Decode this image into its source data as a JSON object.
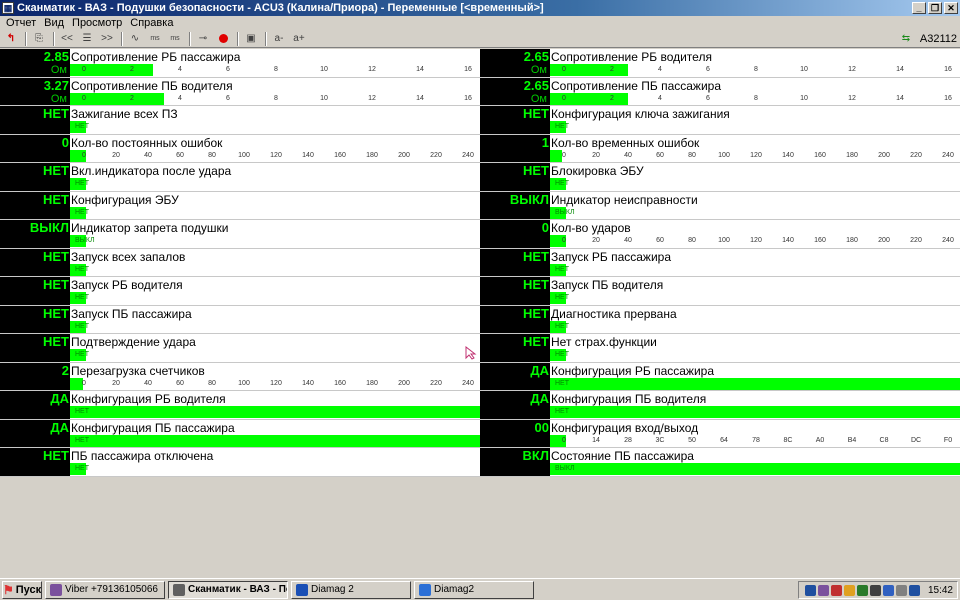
{
  "window": {
    "title": "Сканматик - ВАЗ - Подушки безопасности - ACU3 (Калина/Приора) - Переменные [<временный>]",
    "btn_minimize": "_",
    "btn_restore": "❐",
    "btn_close": "✕"
  },
  "menu": [
    "Отчет",
    "Вид",
    "Просмотр",
    "Справка"
  ],
  "toolbar": {
    "back": "<<",
    "forward": ">>",
    "ms1": "ms",
    "ms2": "ms",
    "a_minus": "a-",
    "a_plus": "a+",
    "vehicle": "А32112"
  },
  "params_left": [
    {
      "value": "2.85",
      "unit": "Ом",
      "name": "Сопротивление РБ пассажира",
      "type": "scale",
      "ticks": [
        "0",
        "2",
        "4",
        "6",
        "8",
        "10",
        "12",
        "14",
        "16"
      ],
      "bar_fraction": 0.178
    },
    {
      "value": "3.27",
      "unit": "Ом",
      "name": "Сопротивление ПБ водителя",
      "type": "scale",
      "ticks": [
        "0",
        "2",
        "4",
        "6",
        "8",
        "10",
        "12",
        "14",
        "16"
      ],
      "bar_fraction": 0.204
    },
    {
      "value": "НЕТ",
      "name": "Зажигание всех ПЗ",
      "type": "bool",
      "bar_text": "НЕТ"
    },
    {
      "value": "0",
      "name": "Кол-во постоянных ошибок",
      "type": "scale",
      "ticks": [
        "0",
        "20",
        "40",
        "60",
        "80",
        "100",
        "120",
        "140",
        "160",
        "180",
        "200",
        "220",
        "240"
      ],
      "bar_fraction": 0
    },
    {
      "value": "НЕТ",
      "name": "Вкл.индикатора после удара",
      "type": "bool",
      "bar_text": "НЕТ"
    },
    {
      "value": "НЕТ",
      "name": "Конфигурация ЭБУ",
      "type": "bool",
      "bar_text": "НЕТ"
    },
    {
      "value": "ВЫКЛ",
      "name": "Индикатор запрета подушки",
      "type": "bool",
      "bar_text": "ВЫКЛ"
    },
    {
      "value": "НЕТ",
      "name": "Запуск всех запалов",
      "type": "bool",
      "bar_text": "НЕТ"
    },
    {
      "value": "НЕТ",
      "name": "Запуск РБ водителя",
      "type": "bool",
      "bar_text": "НЕТ"
    },
    {
      "value": "НЕТ",
      "name": "Запуск ПБ пассажира",
      "type": "bool",
      "bar_text": "НЕТ"
    },
    {
      "value": "НЕТ",
      "name": "Подтверждение удара",
      "type": "bool",
      "bar_text": "НЕТ"
    },
    {
      "value": "2",
      "name": "Перезагрузка счетчиков",
      "type": "scale",
      "ticks": [
        "0",
        "20",
        "40",
        "60",
        "80",
        "100",
        "120",
        "140",
        "160",
        "180",
        "200",
        "220",
        "240"
      ],
      "bar_fraction": 0.008
    },
    {
      "value": "ДА",
      "name": "Конфигурация РБ водителя",
      "type": "full",
      "bar_text": "НЕТ"
    },
    {
      "value": "ДА",
      "name": "Конфигурация ПБ пассажира",
      "type": "full",
      "bar_text": "НЕТ"
    },
    {
      "value": "НЕТ",
      "name": "ПБ пассажира отключена",
      "type": "bool",
      "bar_text": "НЕТ"
    }
  ],
  "params_right": [
    {
      "value": "2.65",
      "unit": "Ом",
      "name": "Сопротивление РБ водителя",
      "type": "scale",
      "ticks": [
        "0",
        "2",
        "4",
        "6",
        "8",
        "10",
        "12",
        "14",
        "16"
      ],
      "bar_fraction": 0.166
    },
    {
      "value": "2.65",
      "unit": "Ом",
      "name": "Сопротивление ПБ пассажира",
      "type": "scale",
      "ticks": [
        "0",
        "2",
        "4",
        "6",
        "8",
        "10",
        "12",
        "14",
        "16"
      ],
      "bar_fraction": 0.166
    },
    {
      "value": "НЕТ",
      "name": "Конфигурация ключа зажигания",
      "type": "bool",
      "bar_text": "НЕТ"
    },
    {
      "value": "1",
      "name": "Кол-во временных ошибок",
      "type": "scale",
      "ticks": [
        "0",
        "20",
        "40",
        "60",
        "80",
        "100",
        "120",
        "140",
        "160",
        "180",
        "200",
        "220",
        "240"
      ],
      "bar_fraction": 0.004
    },
    {
      "value": "НЕТ",
      "name": "Блокировка ЭБУ",
      "type": "bool",
      "bar_text": "НЕТ"
    },
    {
      "value": "ВЫКЛ",
      "name": "Индикатор неисправности",
      "type": "bool",
      "bar_text": "ВЫКЛ"
    },
    {
      "value": "0",
      "name": "Кол-во ударов",
      "type": "scale",
      "ticks": [
        "0",
        "20",
        "40",
        "60",
        "80",
        "100",
        "120",
        "140",
        "160",
        "180",
        "200",
        "220",
        "240"
      ],
      "bar_fraction": 0
    },
    {
      "value": "НЕТ",
      "name": "Запуск РБ пассажира",
      "type": "bool",
      "bar_text": "НЕТ"
    },
    {
      "value": "НЕТ",
      "name": "Запуск ПБ водителя",
      "type": "bool",
      "bar_text": "НЕТ"
    },
    {
      "value": "НЕТ",
      "name": "Диагностика прервана",
      "type": "bool",
      "bar_text": "НЕТ"
    },
    {
      "value": "НЕТ",
      "name": "Нет страх.функции",
      "type": "bool",
      "bar_text": "НЕТ"
    },
    {
      "value": "ДА",
      "name": "Конфигурация РБ пассажира",
      "type": "full",
      "bar_text": "НЕТ"
    },
    {
      "value": "ДА",
      "name": "Конфигурация ПБ водителя",
      "type": "full",
      "bar_text": "НЕТ"
    },
    {
      "value": "00",
      "name": "Конфигурация вход/выход",
      "type": "scale",
      "ticks": [
        "0",
        "14",
        "28",
        "3C",
        "50",
        "64",
        "78",
        "8C",
        "A0",
        "B4",
        "C8",
        "DC",
        "F0"
      ],
      "bar_fraction": 0
    },
    {
      "value": "ВКЛ",
      "name": "Состояние ПБ пассажира",
      "type": "full",
      "bar_text": "ВЫКЛ"
    }
  ],
  "taskbar": {
    "start": "Пуск",
    "tasks": [
      {
        "label": "Viber +79136105066",
        "icon": "viber-icon",
        "color": "#7b519d",
        "active": false
      },
      {
        "label": "Сканматик - ВАЗ - По...",
        "icon": "scanmatik-icon",
        "color": "#606060",
        "active": true
      },
      {
        "label": "Diamag 2",
        "icon": "diamag-icon",
        "color": "#1a4fb5",
        "active": false
      },
      {
        "label": "Diamag2",
        "icon": "help-icon",
        "color": "#2b6fd6",
        "active": false
      }
    ],
    "clock": "15:42"
  },
  "colors": {
    "accent": "#00ff00",
    "value_bg": "#000000",
    "value_text": "#00ff00"
  }
}
